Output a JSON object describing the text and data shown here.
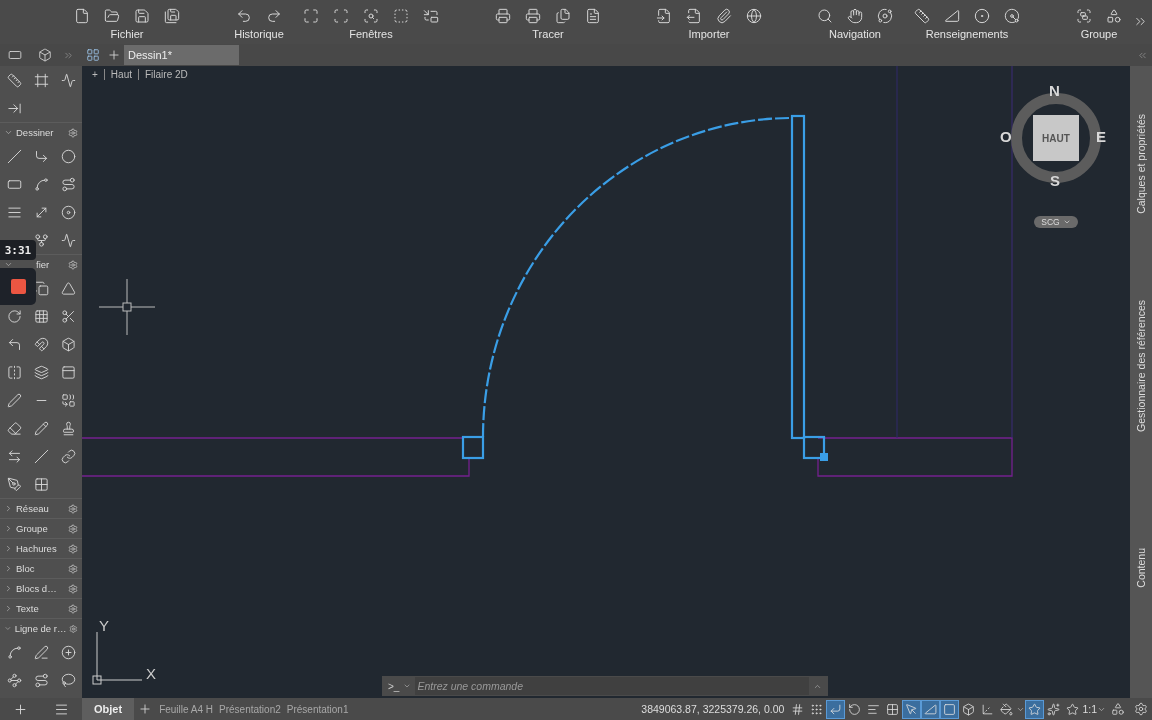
{
  "ribbon": {
    "groups": [
      {
        "label": "Fichier"
      },
      {
        "label": "Historique"
      },
      {
        "label": "Fenêtres"
      },
      {
        "label": "Tracer"
      },
      {
        "label": "Importer"
      },
      {
        "label": "Navigation"
      },
      {
        "label": "Renseignements"
      },
      {
        "label": "Groupe"
      }
    ]
  },
  "drawing_tabs": [
    {
      "label": "Dessin1*",
      "selected": true
    }
  ],
  "panel": {
    "sections": [
      {
        "label": "Dessiner",
        "expanded": true
      },
      {
        "label": "fier",
        "expanded": true
      },
      {
        "label": "Réseau",
        "expanded": false
      },
      {
        "label": "Groupe",
        "expanded": false
      },
      {
        "label": "Hachures",
        "expanded": false
      },
      {
        "label": "Bloc",
        "expanded": false
      },
      {
        "label": "Blocs d…",
        "expanded": false
      },
      {
        "label": "Texte",
        "expanded": false
      },
      {
        "label": "Ligne de r…",
        "expanded": true
      }
    ]
  },
  "recorder": {
    "timer": "3:31"
  },
  "viewport": {
    "controls": [
      "+",
      "Haut",
      "Filaire 2D"
    ]
  },
  "viewcube": {
    "face": "HAUT",
    "north": "N",
    "south": "S",
    "east": "E",
    "west": "O",
    "ucs": "SCG"
  },
  "ucs_icon": {
    "x": "X",
    "y": "Y"
  },
  "command_line": {
    "prompt": ">_",
    "placeholder": "Entrez une commande"
  },
  "right_panel": {
    "tabs": [
      "Calques et propriétés",
      "Gestionnaire des références",
      "Contenu"
    ]
  },
  "layout_tabs": [
    {
      "label": "Objet",
      "selected": true
    },
    {
      "label": "Feuille A4 H",
      "selected": false
    },
    {
      "label": "Présentation2",
      "selected": false
    },
    {
      "label": "Présentation1",
      "selected": false
    }
  ],
  "status_bar": {
    "coordinates": "3849063.87, 3225379.26, 0.00",
    "toggles": [
      {
        "on": false
      },
      {
        "on": false
      },
      {
        "on": true
      },
      {
        "on": false
      },
      {
        "on": false
      },
      {
        "on": false
      },
      {
        "on": true
      },
      {
        "on": true
      },
      {
        "on": true
      },
      {
        "on": false
      },
      {
        "on": false
      },
      {
        "on": false
      }
    ],
    "annotation": [
      {
        "on": true
      },
      {
        "on": false
      },
      {
        "on": false
      }
    ],
    "scale": "1:1"
  }
}
